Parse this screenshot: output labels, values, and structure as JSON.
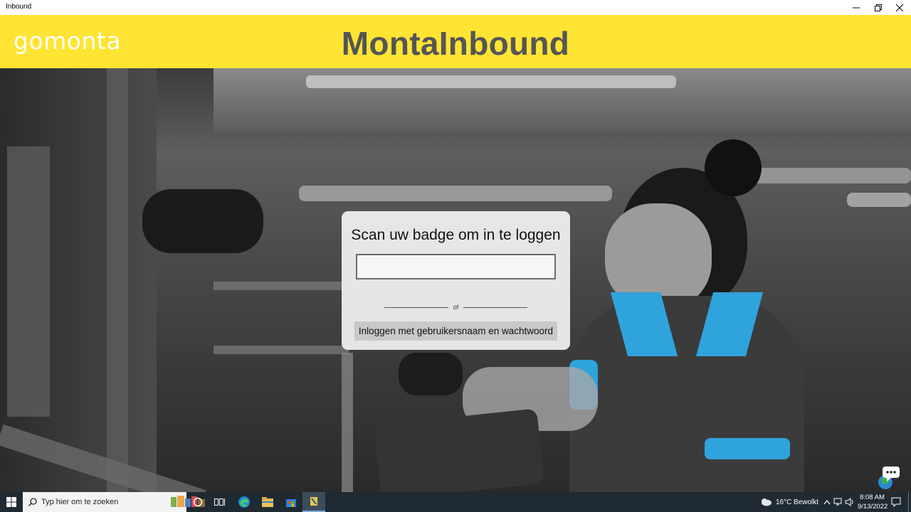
{
  "window": {
    "title": "Inbound",
    "controls": [
      "minimize-icon",
      "restore-icon",
      "close-icon"
    ]
  },
  "header": {
    "logo_go": "go",
    "logo_rest": "monta",
    "app_title": "MontaInbound",
    "accent_color": "#ffe433"
  },
  "login": {
    "title": "Scan uw badge om in te loggen",
    "badge_value": "",
    "divider_text": "of",
    "alt_button_label": "Inloggen met gebruikersnaam en wachtwoord"
  },
  "taskbar": {
    "search_placeholder": "Typ hier om te zoeken",
    "weather_temp": "16°C",
    "weather_text": "Bewolkt",
    "time": "8:08 AM",
    "date": "9/13/2022",
    "icons": [
      "start-icon",
      "search-icon",
      "cortana-icon",
      "task-view-icon",
      "edge-icon",
      "file-explorer-icon",
      "store-icon",
      "inbound-app-icon",
      "cloud-icon",
      "chevron-up-icon",
      "network-icon",
      "volume-icon",
      "notification-icon"
    ]
  }
}
